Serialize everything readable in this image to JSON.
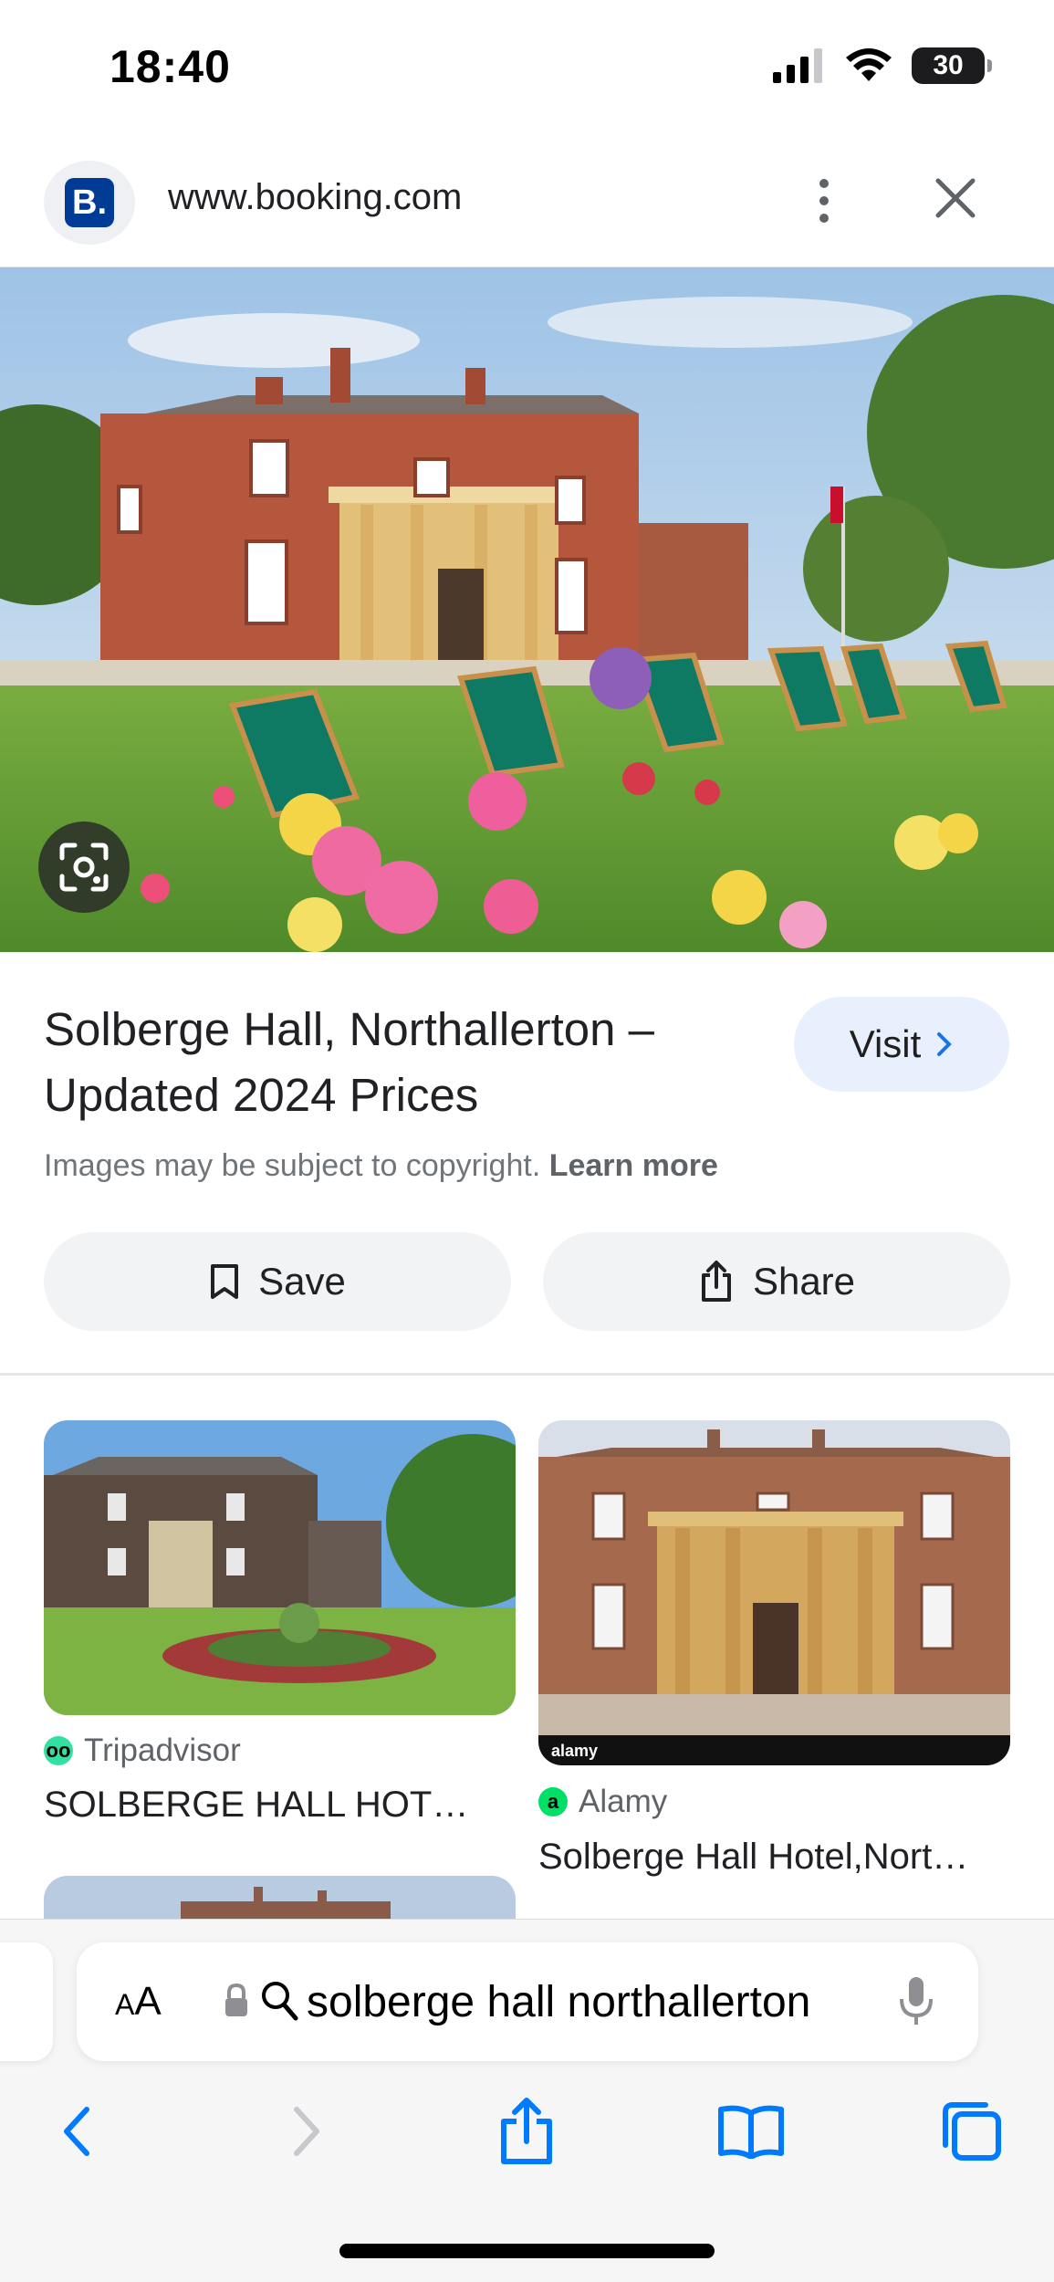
{
  "status_bar": {
    "time": "18:40",
    "battery": "30",
    "icons": [
      "signal-icon",
      "wifi-icon",
      "battery-icon"
    ]
  },
  "header": {
    "favicon_letter": "B.",
    "url": "www.booking.com",
    "icons": [
      "more-vert-icon",
      "close-icon"
    ]
  },
  "result": {
    "title": "Solberge Hall, Northallerton – Updated 2024 Prices",
    "visit_label": "Visit",
    "copyright_text": "Images may be subject to copyright.",
    "learn_more": "Learn more",
    "save_label": "Save",
    "share_label": "Share"
  },
  "related": [
    {
      "source": "Tripadvisor",
      "source_glyph": "oo",
      "title": "SOLBERGE HALL HOT…"
    },
    {
      "source": "Alamy",
      "source_glyph": "a",
      "title": "Solberge Hall Hotel,Nort…"
    }
  ],
  "watermark": {
    "alamy": "alamy"
  },
  "bottom_bar": {
    "aa_small": "A",
    "aa_large": "A",
    "address": "solberge hall northallerton"
  },
  "colors": {
    "visit_bg": "#e8f0fe",
    "button_bg": "#f1f3f4",
    "booking_blue": "#003b95",
    "ios_blue": "#007aff",
    "tripadvisor_green": "#34e0a1",
    "alamy_green": "#00df66"
  }
}
